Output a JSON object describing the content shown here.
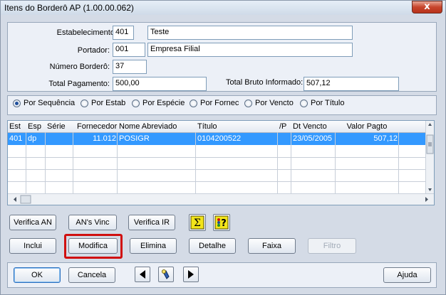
{
  "window": {
    "title": "Itens do Borderô AP (1.00.00.062)",
    "close_glyph": "x"
  },
  "header": {
    "estabelecimento_label": "Estabelecimento:",
    "estabelecimento_code": "401",
    "estabelecimento_name": "Teste",
    "portador_label": "Portador:",
    "portador_code": "001",
    "portador_name": "Empresa Filial",
    "numero_label": "Número Borderô:",
    "numero_value": "37",
    "total_pag_label": "Total Pagamento:",
    "total_pag_value": "500,00",
    "total_bruto_label": "Total Bruto Informado:",
    "total_bruto_value": "507,12"
  },
  "sort": {
    "options": [
      "Por Sequência",
      "Por Estab",
      "Por Espécie",
      "Por Fornec",
      "Por Vencto",
      "Por Título"
    ],
    "selected": "Por Sequência"
  },
  "table": {
    "columns": [
      "Est",
      "Esp",
      "Série",
      "Fornecedor",
      "Nome Abreviado",
      "Título",
      "/P",
      "Dt Vencto",
      "Valor Pagto"
    ],
    "rows": [
      [
        "401",
        "dp",
        "",
        "11.012",
        "POSIGR",
        "0104200522",
        "",
        "23/05/2005",
        "507,12"
      ]
    ]
  },
  "actions": {
    "verifica_an": "Verifica AN",
    "ans_vinc": "AN's Vinc",
    "verifica_ir": "Verifica IR",
    "inclui": "Inclui",
    "modifica": "Modifica",
    "elimina": "Elimina",
    "detalhe": "Detalhe",
    "faixa": "Faixa",
    "filtro": "Filtro"
  },
  "footer": {
    "ok": "OK",
    "cancela": "Cancela",
    "ajuda": "Ajuda"
  },
  "colors": {
    "highlight": "#d01010",
    "selection": "#3399ff"
  }
}
